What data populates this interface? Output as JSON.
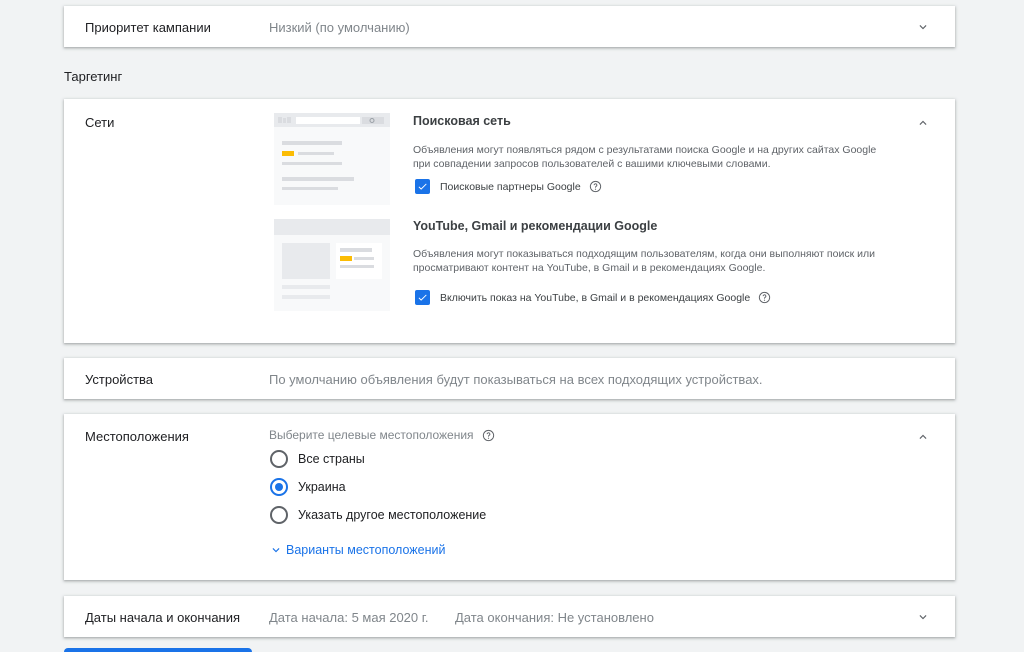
{
  "priority": {
    "title": "Приоритет кампании",
    "value": "Низкий (по умолчанию)"
  },
  "targeting": {
    "heading": "Таргетинг"
  },
  "networks": {
    "title": "Сети",
    "search": {
      "title": "Поисковая сеть",
      "description": "Объявления могут появляться рядом с результатами поиска Google и на других сайтах Google при совпадении запросов пользователей с вашими ключевыми словами.",
      "checkbox_label": "Поисковые партнеры Google",
      "checked": true
    },
    "display": {
      "title": "YouTube, Gmail и рекомендации Google",
      "description": "Объявления могут показываться подходящим пользователям, когда они выполняют поиск или просматривают контент на YouTube, в Gmail и в рекомендациях Google.",
      "checkbox_label": "Включить показ на YouTube, в Gmail и в рекомендациях Google",
      "checked": true
    }
  },
  "devices": {
    "title": "Устройства",
    "summary": "По умолчанию объявления будут показываться на всех подходящих устройствах."
  },
  "locations": {
    "title": "Местоположения",
    "prompt": "Выберите целевые местоположения",
    "options": [
      {
        "label": "Все страны",
        "selected": false
      },
      {
        "label": "Украина",
        "selected": true
      },
      {
        "label": "Указать другое местоположение",
        "selected": false
      }
    ],
    "more_link": "Варианты местоположений"
  },
  "dates": {
    "title": "Даты начала и окончания",
    "start": "Дата начала: 5 мая 2020 г.",
    "end": "Дата окончания: Не установлено"
  },
  "colors": {
    "accent": "#1a73e8",
    "background": "#f1f3f4",
    "highlight": "#fbbc04"
  }
}
